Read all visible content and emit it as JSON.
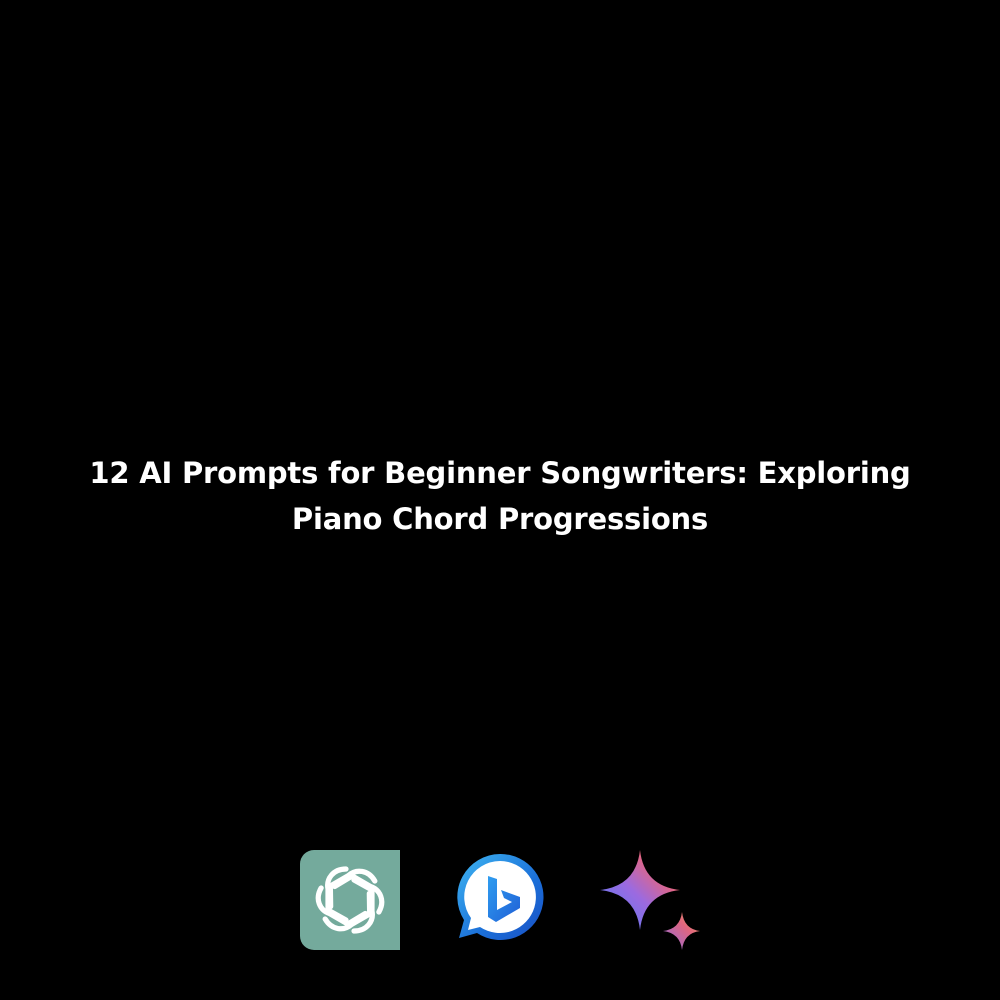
{
  "title_lines": [
    "12 AI Prompts for Beginner Songwriters: Exploring",
    "Piano Chord Progressions"
  ],
  "logos": [
    {
      "icon": "openai-chatgpt-logo-icon",
      "bg_color": "#74aa9c",
      "fg_color": "#ffffff"
    },
    {
      "icon": "bing-chat-logo-icon",
      "colors": [
        "#1b6fd8",
        "#3fb6f2",
        "#ffffff"
      ]
    },
    {
      "icon": "gemini-sparkle-logo-icon",
      "colors": [
        "#4f7ef6",
        "#b06ad6",
        "#e9657a",
        "#f0a35c"
      ]
    }
  ],
  "colors": {
    "background": "#000000",
    "text": "#ffffff"
  }
}
